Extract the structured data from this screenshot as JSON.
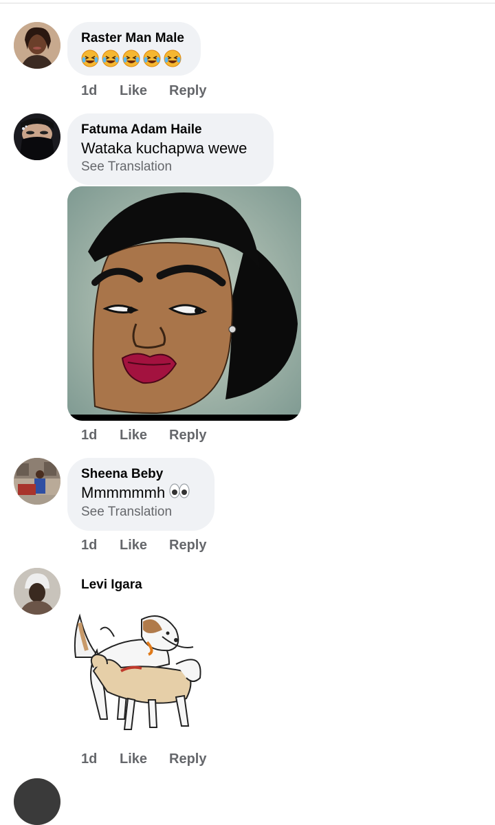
{
  "comments": [
    {
      "author": "Raster Man Male",
      "emoji_text": "🤣🤣🤣🤣🤣",
      "time": "1d",
      "like": "Like",
      "reply": "Reply"
    },
    {
      "author": "Fatuma Adam Haile",
      "text": "Wataka kuchapwa wewe",
      "translation": "See Translation",
      "time": "1d",
      "like": "Like",
      "reply": "Reply",
      "attachment": "cartoon-face-image"
    },
    {
      "author": "Sheena Beby",
      "text": "Mmmmmmh",
      "emoji": "eyes",
      "translation": "See Translation",
      "time": "1d",
      "like": "Like",
      "reply": "Reply"
    },
    {
      "author": "Levi Igara",
      "attachment": "dogs-sticker",
      "time": "1d",
      "like": "Like",
      "reply": "Reply"
    }
  ],
  "colors": {
    "bubble": "#f0f2f5",
    "meta": "#65676b",
    "text": "#050505"
  }
}
